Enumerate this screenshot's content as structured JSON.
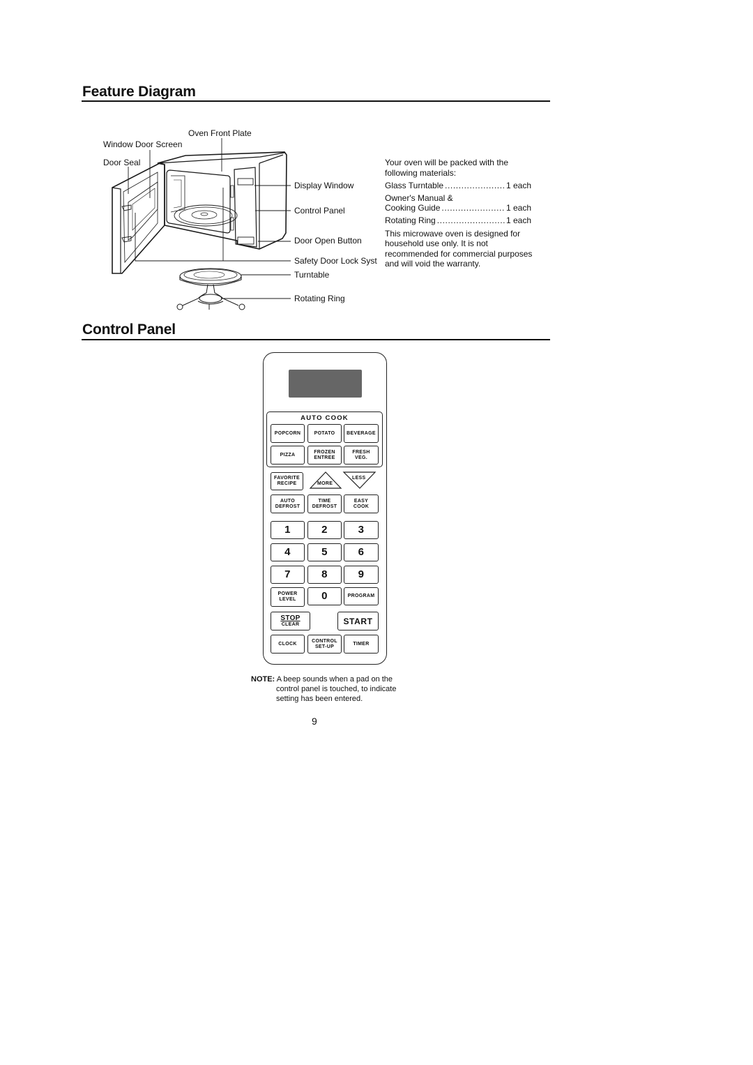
{
  "sections": {
    "feature_diagram": {
      "title": "Feature Diagram"
    },
    "control_panel": {
      "title": "Control Panel"
    }
  },
  "diagram_labels": {
    "oven_front_plate": "Oven Front Plate",
    "window_door_screen": "Window Door Screen",
    "door_seal": "Door Seal",
    "display_window": "Display Window",
    "control_panel": "Control Panel",
    "door_open_button": "Door Open Button",
    "safety_door_lock": "Safety Door Lock Syst",
    "turntable": "Turntable",
    "rotating_ring": "Rotating Ring"
  },
  "packed_materials": {
    "intro": "Your oven will be packed with the following materials:",
    "items": [
      {
        "name": "Glass Turntable",
        "qty": "1 each"
      },
      {
        "name_line1": "Owner's Manual &",
        "name": "Cooking Guide",
        "qty": "1 each"
      },
      {
        "name": "Rotating Ring",
        "qty": "1 each"
      }
    ],
    "disclaimer": "This microwave oven is designed for household use only. It is not recommended for commercial purposes and will void the warranty."
  },
  "keypad": {
    "auto_cook_title": "AUTO COOK",
    "auto_cook": [
      [
        "POPCORN"
      ],
      [
        "POTATO"
      ],
      [
        "BEVERAGE"
      ],
      [
        "PIZZA"
      ],
      [
        "FROZEN",
        "ENTREE"
      ],
      [
        "FRESH",
        "VEG."
      ]
    ],
    "favorite": [
      "FAVORITE",
      "RECIPE"
    ],
    "more": "MORE",
    "less": "LESS",
    "defrost_row": [
      [
        "AUTO",
        "DEFROST"
      ],
      [
        "TIME",
        "DEFROST"
      ],
      [
        "EASY",
        "COOK"
      ]
    ],
    "digits": [
      "1",
      "2",
      "3",
      "4",
      "5",
      "6",
      "7",
      "8",
      "9",
      "0"
    ],
    "power_level": [
      "POWER",
      "LEVEL"
    ],
    "program": "PROGRAM",
    "stop": "STOP",
    "clear": "CLEAR",
    "start": "START",
    "clock": "CLOCK",
    "control_setup": [
      "CONTROL",
      "SET-UP"
    ],
    "timer": "TIMER"
  },
  "note": {
    "label": "NOTE:",
    "line1": "A beep sounds when a pad on the",
    "line2": "control panel is touched, to indicate",
    "line3": "setting has been entered."
  },
  "page_number": "9"
}
